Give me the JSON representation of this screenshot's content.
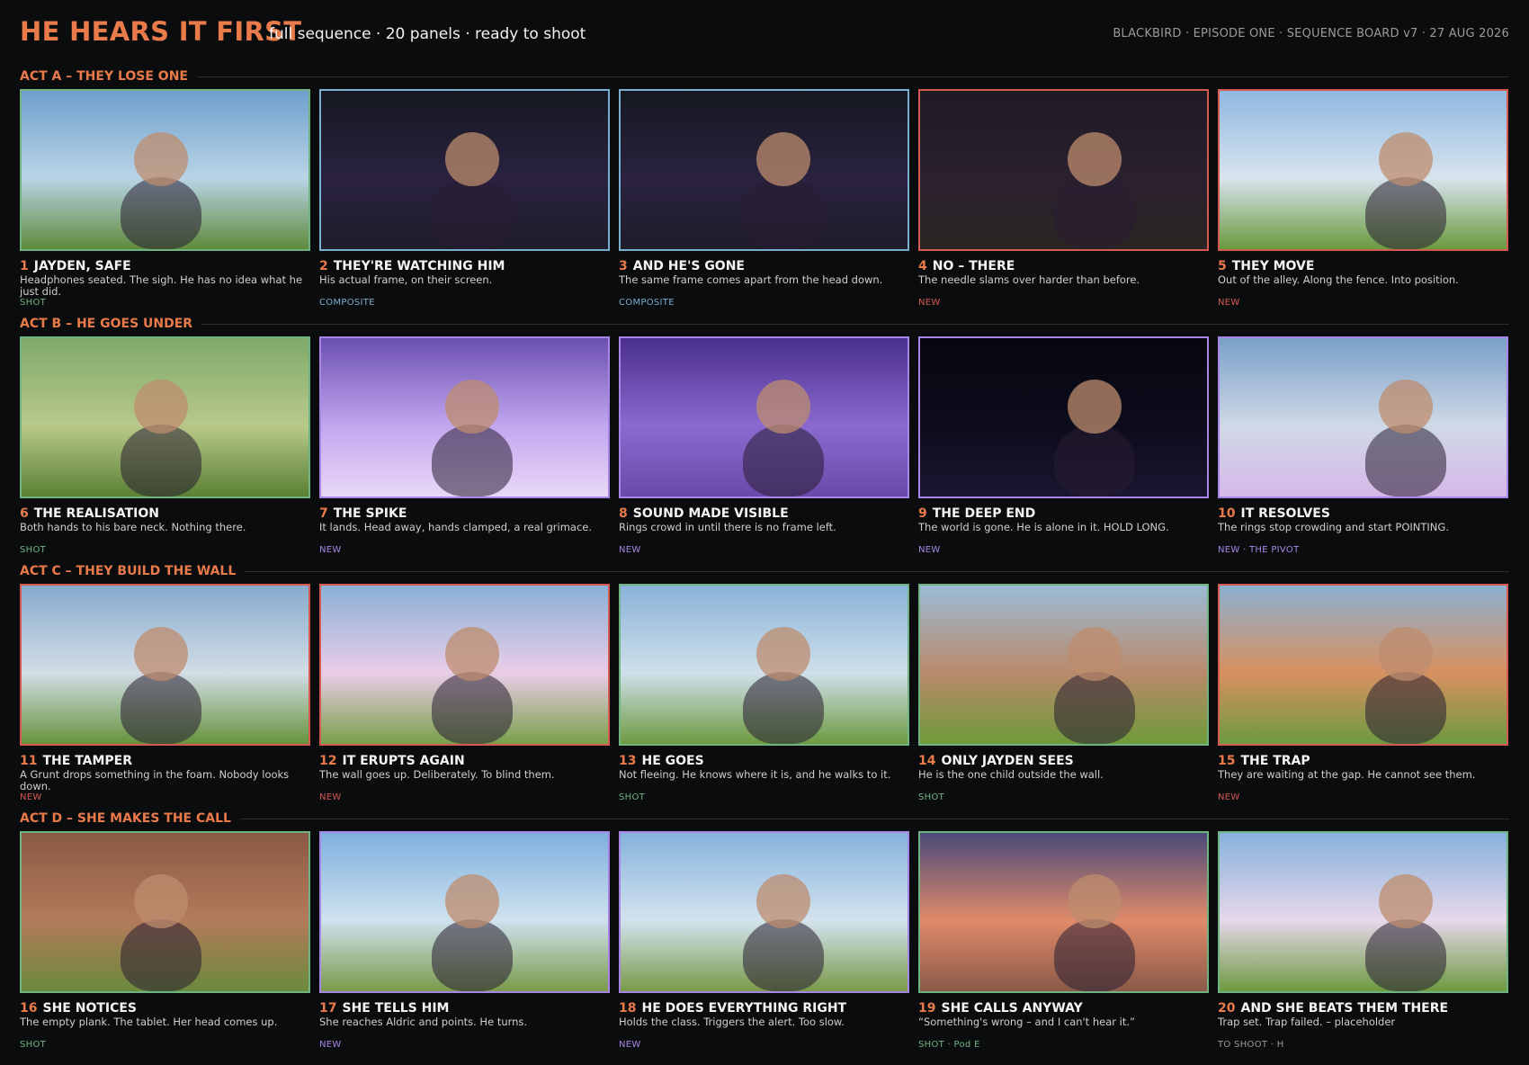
{
  "header": {
    "title": "HE HEARS IT FIRST",
    "subtitle": "full sequence · 20 panels · ready to shoot",
    "meta": "BLACKBIRD · EPISODE ONE · SEQUENCE BOARD v7 · 27 AUG 2026"
  },
  "acts": [
    {
      "title": "ACT A – THEY LOSE ONE",
      "panels": [
        {
          "num": "1",
          "title": "JAYDEN, SAFE",
          "desc": "Headphones seated. The sigh. He has no idea what he just did.",
          "tag": "SHOT"
        },
        {
          "num": "2",
          "title": "THEY'RE WATCHING HIM",
          "desc": "His actual frame, on their screen.",
          "tag": "COMPOSITE"
        },
        {
          "num": "3",
          "title": "AND HE'S GONE",
          "desc": "The same frame comes apart from the head down.",
          "tag": "COMPOSITE"
        },
        {
          "num": "4",
          "title": "NO – THERE",
          "desc": "The needle slams over harder than before.",
          "tag": "NEW"
        },
        {
          "num": "5",
          "title": "THEY MOVE",
          "desc": "Out of the alley. Along the fence. Into position.",
          "tag": "NEW"
        }
      ]
    },
    {
      "title": "ACT B – HE GOES UNDER",
      "panels": [
        {
          "num": "6",
          "title": "THE REALISATION",
          "desc": "Both hands to his bare neck. Nothing there.",
          "tag": "SHOT"
        },
        {
          "num": "7",
          "title": "THE SPIKE",
          "desc": "It lands. Head away, hands clamped, a real grimace.",
          "tag": "NEW"
        },
        {
          "num": "8",
          "title": "SOUND MADE VISIBLE",
          "desc": "Rings crowd in until there is no frame left.",
          "tag": "NEW"
        },
        {
          "num": "9",
          "title": "THE DEEP END",
          "desc": "The world is gone. He is alone in it. HOLD LONG.",
          "tag": "NEW"
        },
        {
          "num": "10",
          "title": "IT RESOLVES",
          "desc": "The rings stop crowding and start POINTING.",
          "tag": "NEW · THE PIVOT"
        }
      ]
    },
    {
      "title": "ACT C – THEY BUILD THE WALL",
      "panels": [
        {
          "num": "11",
          "title": "THE TAMPER",
          "desc": "A Grunt drops something in the foam. Nobody looks down.",
          "tag": "NEW"
        },
        {
          "num": "12",
          "title": "IT ERUPTS AGAIN",
          "desc": "The wall goes up. Deliberately. To blind them.",
          "tag": "NEW"
        },
        {
          "num": "13",
          "title": "HE GOES",
          "desc": "Not fleeing. He knows where it is, and he walks to it.",
          "tag": "SHOT"
        },
        {
          "num": "14",
          "title": "ONLY JAYDEN SEES",
          "desc": "He is the one child outside the wall.",
          "tag": "SHOT"
        },
        {
          "num": "15",
          "title": "THE TRAP",
          "desc": "They are waiting at the gap. He cannot see them.",
          "tag": "NEW"
        }
      ]
    },
    {
      "title": "ACT D – SHE MAKES THE CALL",
      "panels": [
        {
          "num": "16",
          "title": "SHE NOTICES",
          "desc": "The empty plank. The tablet. Her head comes up.",
          "tag": "SHOT"
        },
        {
          "num": "17",
          "title": "SHE TELLS HIM",
          "desc": "She reaches Aldric and points. He turns.",
          "tag": "NEW"
        },
        {
          "num": "18",
          "title": "HE DOES EVERYTHING RIGHT",
          "desc": "Holds the class. Triggers the alert. Too slow.",
          "tag": "NEW"
        },
        {
          "num": "19",
          "title": "SHE CALLS ANYWAY",
          "desc": "“Something's wrong – and I can't hear it.”",
          "tag": "SHOT · Pod E"
        },
        {
          "num": "20",
          "title": "AND SHE BEATS THEM THERE",
          "desc": "Trap set. Trap failed. – placeholder",
          "tag": "TO SHOOT · H"
        }
      ]
    }
  ],
  "colors": {
    "accent": "#e97a4a",
    "shot": "#6fb383",
    "composite": "#7aaed0",
    "new_red": "#d45a52",
    "new_purple": "#a787e6"
  }
}
